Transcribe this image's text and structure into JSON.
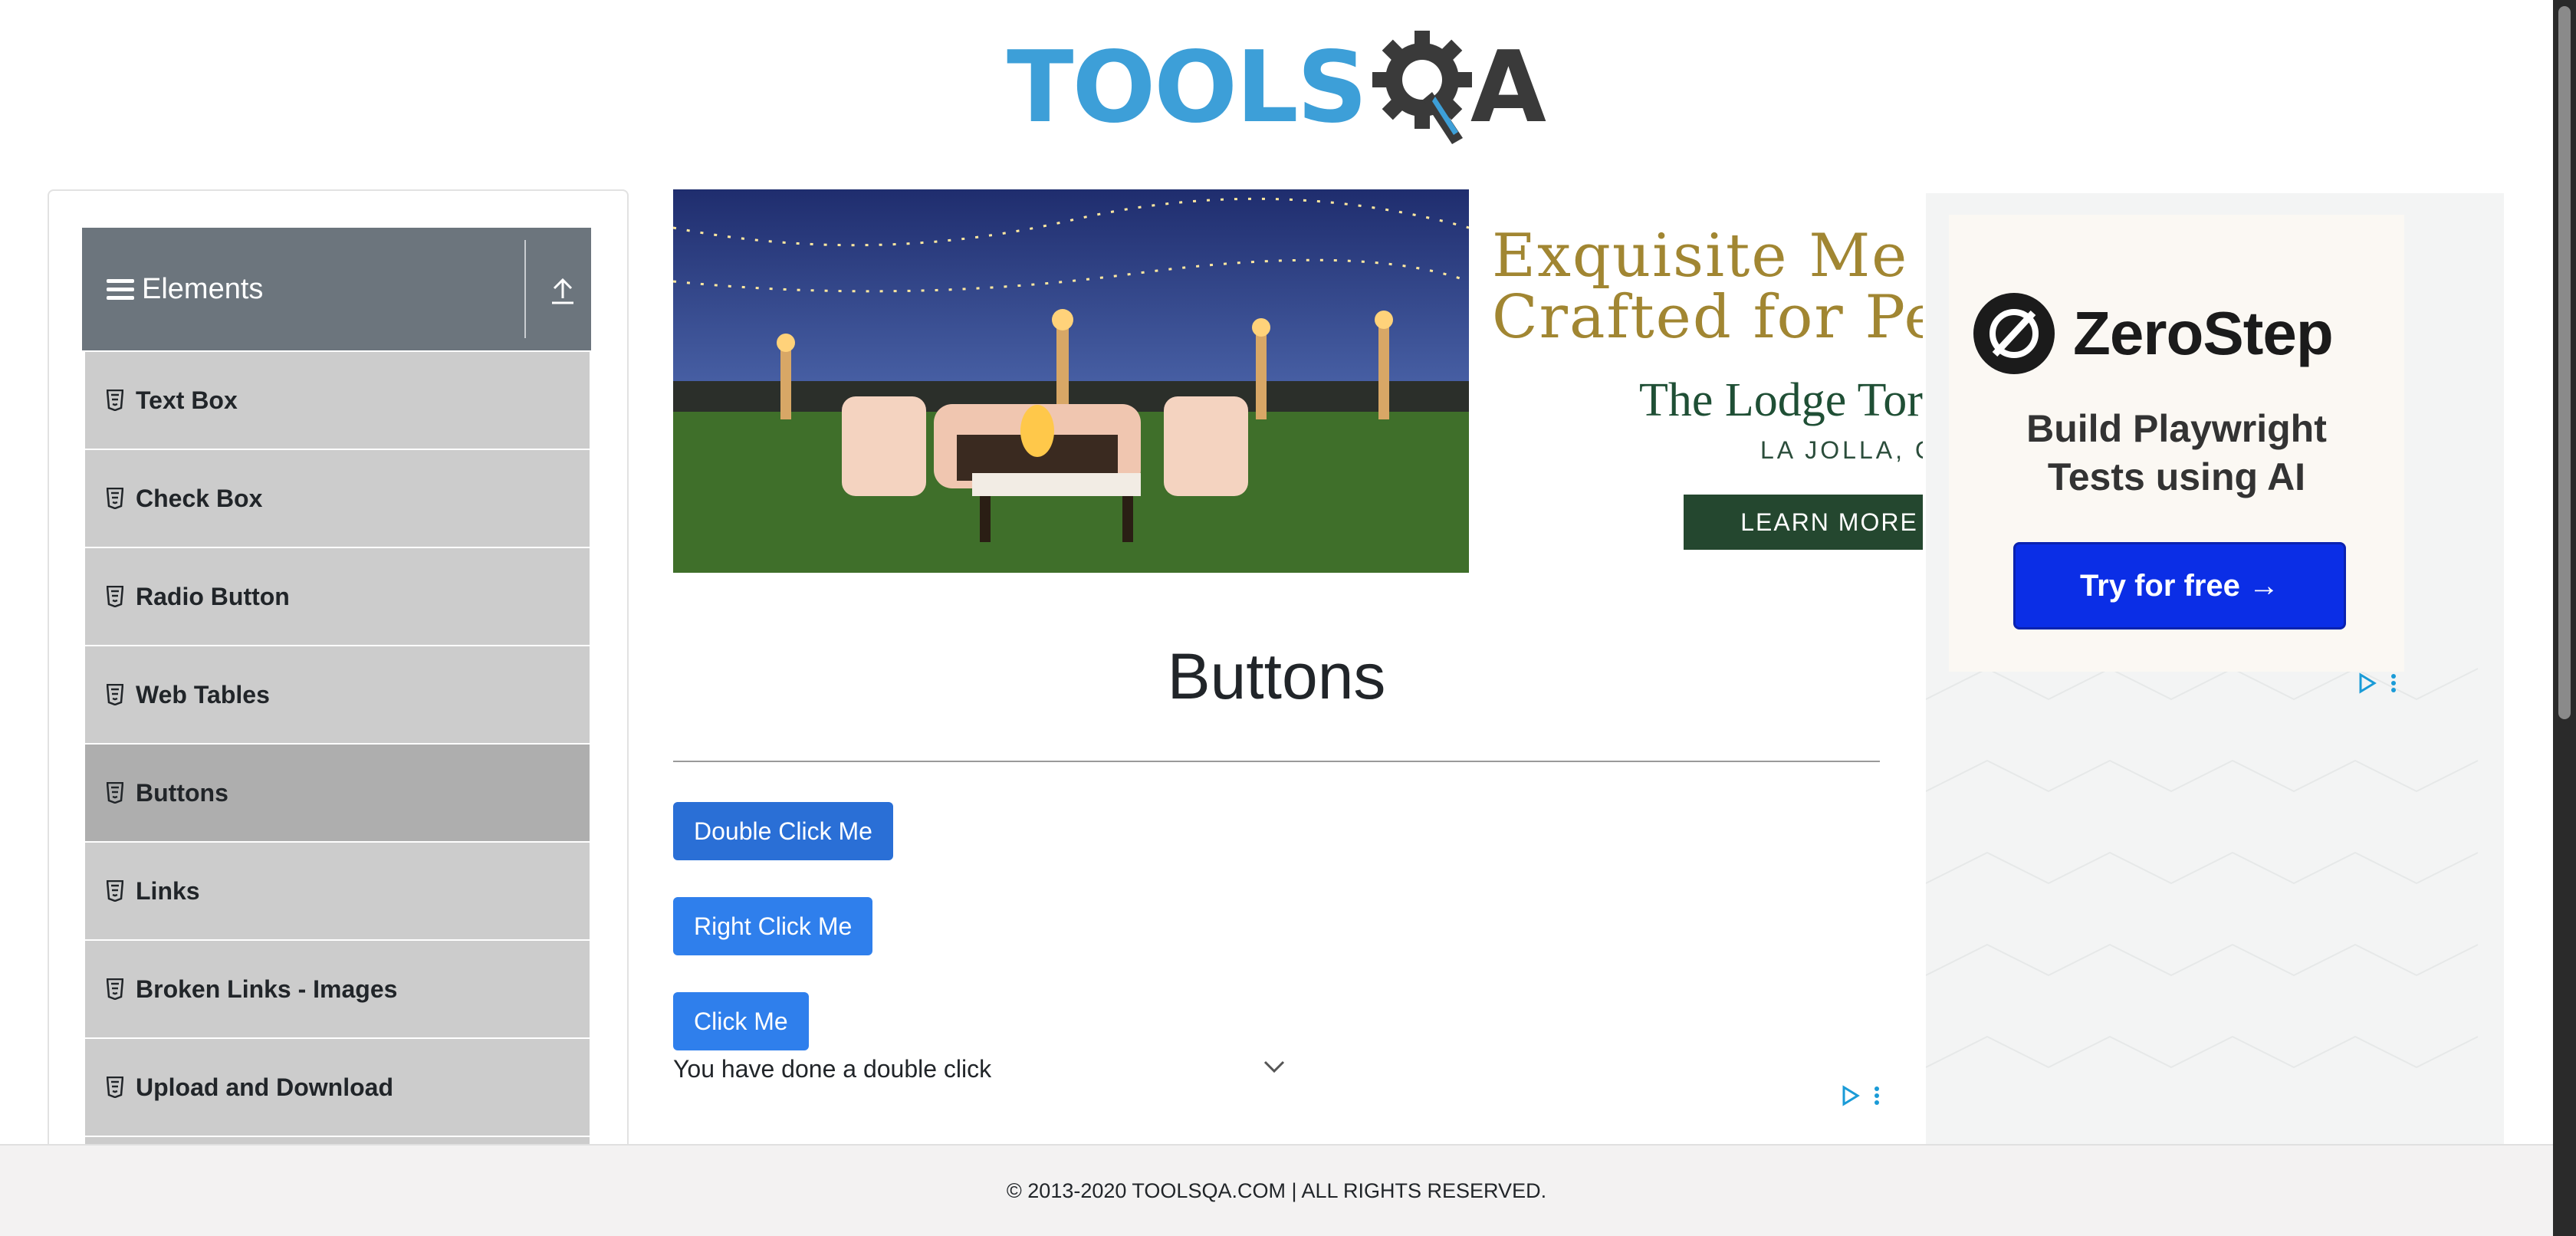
{
  "header": {
    "logo_text_left": "TOOLS",
    "logo_text_right": "A",
    "logo_gear_letter": "Q"
  },
  "sidebar": {
    "group_title": "Elements",
    "items": [
      {
        "label": "Text Box",
        "active": false
      },
      {
        "label": "Check Box",
        "active": false
      },
      {
        "label": "Radio Button",
        "active": false
      },
      {
        "label": "Web Tables",
        "active": false
      },
      {
        "label": "Buttons",
        "active": true
      },
      {
        "label": "Links",
        "active": false
      },
      {
        "label": "Broken Links - Images",
        "active": false
      },
      {
        "label": "Upload and Download",
        "active": false
      }
    ]
  },
  "banner_ad": {
    "headline_line1": "Exquisite Me",
    "headline_line2": "Crafted for Per",
    "brand": "The Lodge Torrey Pi",
    "location": "LA JOLLA, CA",
    "cta": "LEARN MORE"
  },
  "main": {
    "title": "Buttons",
    "buttons": {
      "double_click": "Double Click Me",
      "right_click": "Right Click Me",
      "click": "Click Me"
    },
    "result_message": "You have done a double click"
  },
  "side_ad": {
    "brand": "ZeroStep",
    "tagline_line1": "Build Playwright",
    "tagline_line2": "Tests using AI",
    "cta": "Try for free →"
  },
  "footer": {
    "copyright": "© 2013-2020 TOOLSQA.COM | ALL RIGHTS RESERVED."
  },
  "colors": {
    "primary_button": "#2f7fec",
    "nav_header": "#6c757d",
    "nav_item": "#cccccc",
    "nav_item_active": "#aeaeae",
    "logo_blue": "#3d9fd8",
    "zerostep_cta": "#0b2ee6"
  },
  "icons": [
    "hamburger-icon",
    "collapse-arrow-icon",
    "html5-icon",
    "chevron-down-icon",
    "adchoices-icon",
    "kebab-menu-icon",
    "zerostep-logo-icon",
    "gear-icon"
  ]
}
